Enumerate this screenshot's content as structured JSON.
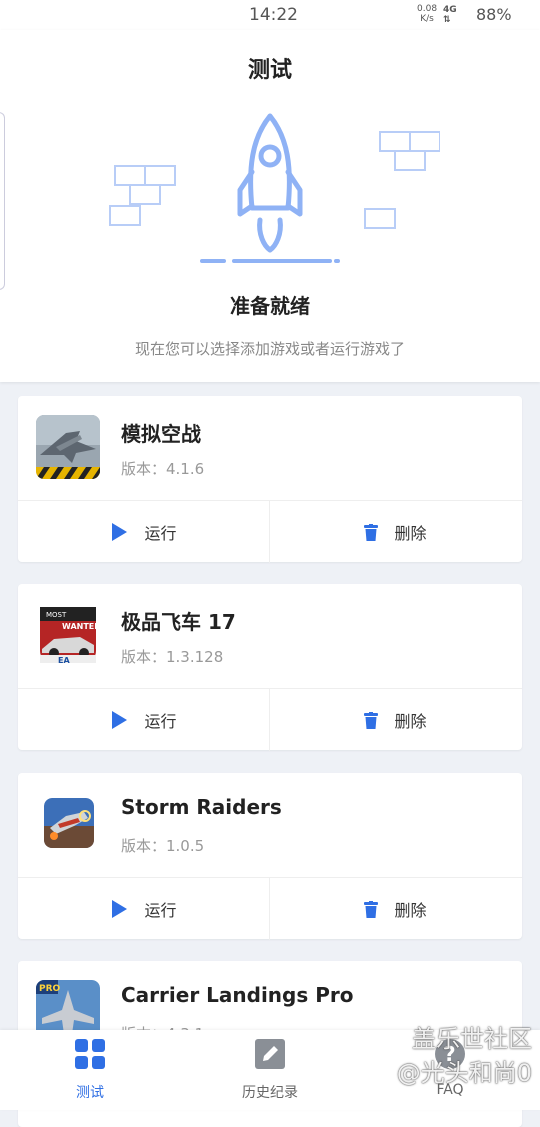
{
  "status_bar": {
    "time": "14:22",
    "net_speed_value": "0.08",
    "net_speed_unit": "K/s",
    "network": "4G",
    "battery": "88%"
  },
  "header": {
    "title": "测试"
  },
  "hero": {
    "status_title": "准备就绪",
    "description": "现在您可以选择添加游戏或者运行游戏了",
    "accent_color": "#8fb2f5"
  },
  "games": [
    {
      "name": "模拟空战",
      "version": "版本：4.1.6",
      "run_label": "运行",
      "delete_label": "删除",
      "icon": "jet-fighter-icon"
    },
    {
      "name": "极品飞车 17",
      "version": "版本：1.3.128",
      "run_label": "运行",
      "delete_label": "删除",
      "icon": "racing-car-icon"
    },
    {
      "name": "Storm Raiders",
      "version": "版本：1.0.5",
      "run_label": "运行",
      "delete_label": "删除",
      "icon": "propeller-plane-icon"
    },
    {
      "name": "Carrier Landings Pro",
      "version": "版本：4.3.1",
      "icon": "carrier-jet-icon"
    }
  ],
  "bottom_nav": {
    "items": [
      {
        "label": "测试",
        "icon": "grid-icon",
        "active": true
      },
      {
        "label": "历史纪录",
        "icon": "edit-icon",
        "active": false
      },
      {
        "label": "FAQ",
        "icon": "help-icon",
        "active": false
      }
    ]
  },
  "watermark": {
    "line1": "盖乐世社区",
    "line2": "@光头和尚0"
  },
  "colors": {
    "primary": "#2f6fe4",
    "inactive": "#999999"
  }
}
